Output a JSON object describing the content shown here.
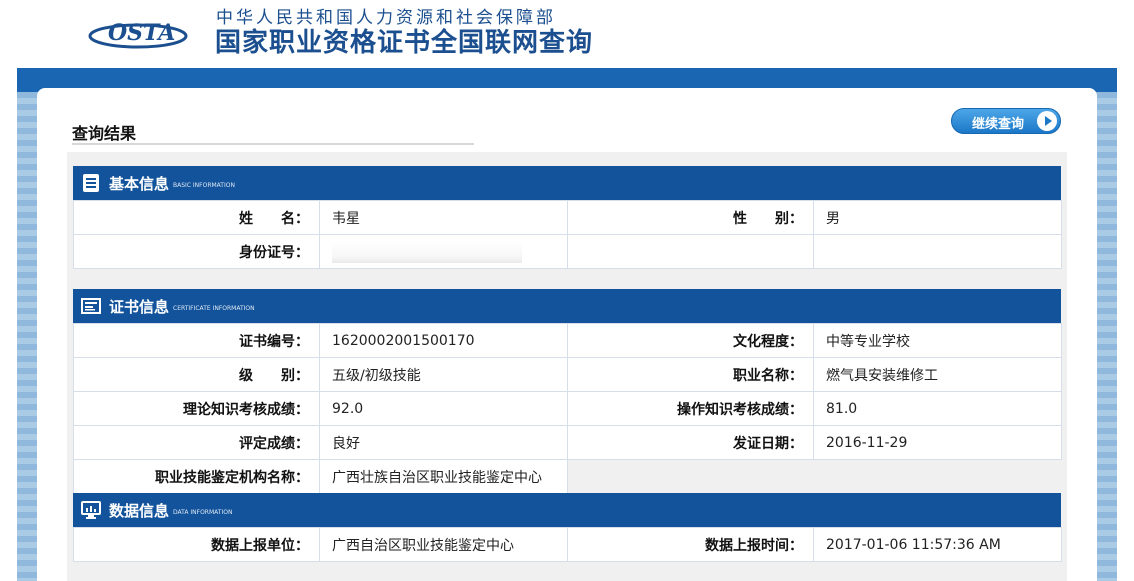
{
  "header": {
    "logo_text": "OSTA",
    "ministry": "中华人民共和国人力资源和社会保障部",
    "site_title": "国家职业资格证书全国联网查询"
  },
  "page": {
    "result_title": "查询结果",
    "continue_button": "继续查询"
  },
  "basic": {
    "title": "基本信息",
    "subtitle": "BASIC INFORMATION",
    "name_label": "姓　　名：",
    "name_value": "韦星",
    "gender_label": "性　　别：",
    "gender_value": "男",
    "id_label": "身份证号：",
    "id_value": ""
  },
  "certificate": {
    "title": "证书信息",
    "subtitle": "CERTIFICATE INFORMATION",
    "cert_no_label": "证书编号：",
    "cert_no_value": "1620002001500170",
    "education_label": "文化程度：",
    "education_value": "中等专业学校",
    "level_label": "级　　别：",
    "level_value": "五级/初级技能",
    "occupation_label": "职业名称：",
    "occupation_value": "燃气具安装维修工",
    "theory_label": "理论知识考核成绩：",
    "theory_value": "92.0",
    "practice_label": "操作知识考核成绩：",
    "practice_value": "81.0",
    "rating_label": "评定成绩：",
    "rating_value": "良好",
    "issue_date_label": "发证日期：",
    "issue_date_value": "2016-11-29",
    "agency_label": "职业技能鉴定机构名称：",
    "agency_value": "广西壮族自治区职业技能鉴定中心"
  },
  "data_info": {
    "title": "数据信息",
    "subtitle": "DATA INFORMATION",
    "unit_label": "数据上报单位：",
    "unit_value": "广西自治区职业技能鉴定中心",
    "time_label": "数据上报时间：",
    "time_value": "2017-01-06 11:57:36 AM"
  },
  "colors": {
    "primary_blue": "#12539b",
    "accent_blue": "#1b4f8f",
    "band_blue": "#1a66b3"
  },
  "icons": {
    "basic": "document-list-icon",
    "certificate": "certificate-card-icon",
    "data": "monitor-chart-icon",
    "continue": "play-arrow-icon"
  }
}
